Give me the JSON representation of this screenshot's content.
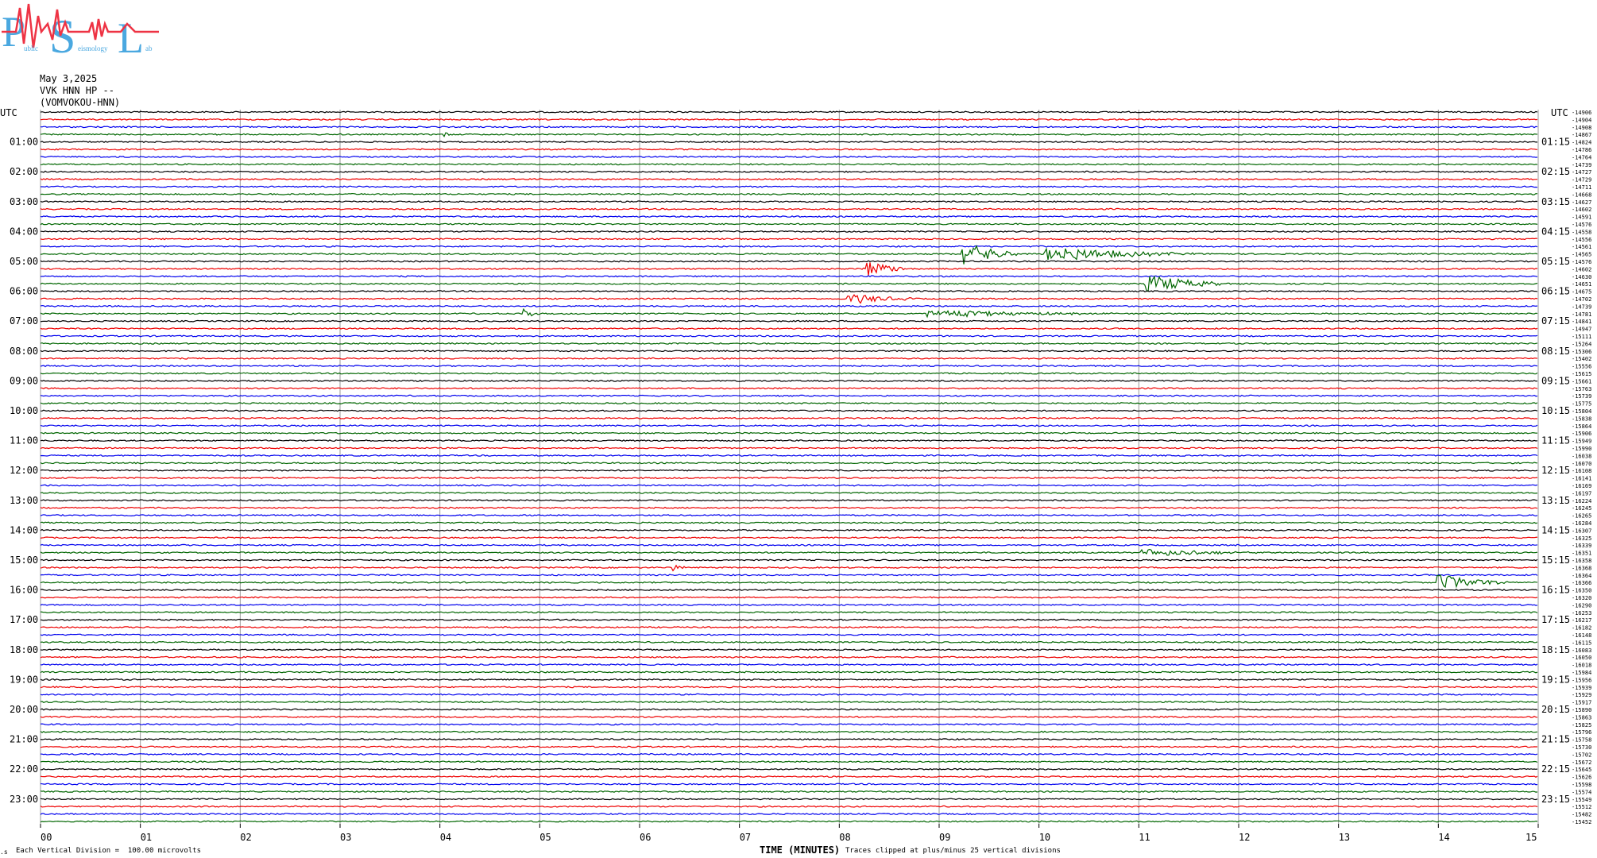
{
  "logo": {
    "letters": [
      "P",
      "S",
      "L"
    ],
    "subtitle_words": [
      "ublic",
      "eismology",
      "ab"
    ],
    "colors": {
      "letters": "#4aa8e0",
      "wave": "#ee3344"
    }
  },
  "header": {
    "date": "May 3,2025",
    "station": "VVK HNN HP --",
    "station_id": "(VOMVOKOU-HNN)"
  },
  "axis": {
    "left_tz": "UTC",
    "right_tz": "UTC",
    "x_label": "TIME (MINUTES)",
    "vertical_division_note": "Each Vertical Division =  100.00 microvolts",
    "clip_note": "Traces clipped at plus/minus 25 vertical divisions",
    "corner_mark": ".s"
  },
  "chart_data": {
    "type": "line",
    "title": "",
    "xlabel": "TIME (MINUTES)",
    "ylabel": "",
    "xlim": [
      0,
      15
    ],
    "x_ticks": [
      "00",
      "01",
      "02",
      "03",
      "04",
      "05",
      "06",
      "07",
      "08",
      "09",
      "10",
      "11",
      "12",
      "13",
      "14",
      "15"
    ],
    "grid": true,
    "trace_colors": [
      "#000000",
      "#ee0000",
      "#0000ee",
      "#006600"
    ],
    "left_hour_labels": [
      "01:00",
      "02:00",
      "03:00",
      "04:00",
      "05:00",
      "06:00",
      "07:00",
      "08:00",
      "09:00",
      "10:00",
      "11:00",
      "12:00",
      "13:00",
      "14:00",
      "15:00",
      "16:00",
      "17:00",
      "18:00",
      "19:00",
      "20:00",
      "21:00",
      "22:00",
      "23:00"
    ],
    "right_hour_labels": [
      "01:15",
      "02:15",
      "03:15",
      "04:15",
      "05:15",
      "06:15",
      "07:15",
      "08:15",
      "09:15",
      "10:15",
      "11:15",
      "12:15",
      "13:15",
      "14:15",
      "15:15",
      "16:15",
      "17:15",
      "18:15",
      "19:15",
      "20:15",
      "21:15",
      "22:15",
      "23:15"
    ],
    "trace_offsets": [
      "-14906",
      "-14904",
      "-14908",
      "-14867",
      "-14824",
      "-14786",
      "-14764",
      "-14739",
      "-14727",
      "-14729",
      "-14711",
      "-14668",
      "-14627",
      "-14602",
      "-14591",
      "-14576",
      "-14558",
      "-14556",
      "-14561",
      "-14565",
      "-14576",
      "-14602",
      "-14630",
      "-14651",
      "-14675",
      "-14702",
      "-14739",
      "-14781",
      "-14841",
      "-14947",
      "-15111",
      "-15264",
      "-15306",
      "-15402",
      "-15556",
      "-15615",
      "-15661",
      "-15763",
      "-15739",
      "-15775",
      "-15804",
      "-15838",
      "-15864",
      "-15906",
      "-15949",
      "-15990",
      "-16038",
      "-16070",
      "-16108",
      "-16141",
      "-16169",
      "-16197",
      "-16224",
      "-16245",
      "-16265",
      "-16284",
      "-16307",
      "-16325",
      "-16339",
      "-16351",
      "-16358",
      "-16368",
      "-16364",
      "-16366",
      "-16350",
      "-16320",
      "-16290",
      "-16253",
      "-16217",
      "-16182",
      "-16148",
      "-16115",
      "-16083",
      "-16050",
      "-16018",
      "-15984",
      "-15956",
      "-15939",
      "-15929",
      "-15917",
      "-15890",
      "-15863",
      "-15825",
      "-15796",
      "-15758",
      "-15730",
      "-15702",
      "-15672",
      "-15645",
      "-15626",
      "-15598",
      "-15574",
      "-15549",
      "-15512",
      "-15482",
      "-15452"
    ],
    "events": [
      {
        "hour": "00:45",
        "minute": 4.05,
        "amplitude": 0.35
      },
      {
        "hour": "04:45",
        "minute": 9.3,
        "amplitude": 1.6,
        "duration": 0.5
      },
      {
        "hour": "04:45",
        "minute": 10.3,
        "amplitude": 0.8,
        "duration": 1.3
      },
      {
        "hour": "05:15",
        "minute": 8.3,
        "amplitude": 1.4,
        "duration": 0.35
      },
      {
        "hour": "05:45",
        "minute": 11.2,
        "amplitude": 1.0,
        "duration": 0.7
      },
      {
        "hour": "06:15",
        "minute": 8.2,
        "amplitude": 0.6,
        "duration": 0.6
      },
      {
        "hour": "06:45",
        "minute": 4.85,
        "amplitude": 0.9,
        "duration": 0.15
      },
      {
        "hour": "06:45",
        "minute": 9.2,
        "amplitude": 0.4,
        "duration": 1.6
      },
      {
        "hour": "14:45",
        "minute": 11.2,
        "amplitude": 0.5,
        "duration": 1.0
      },
      {
        "hour": "15:15",
        "minute": 6.35,
        "amplitude": 0.6,
        "duration": 0.12
      },
      {
        "hour": "15:45",
        "minute": 14.1,
        "amplitude": 1.0,
        "duration": 0.6
      }
    ]
  }
}
